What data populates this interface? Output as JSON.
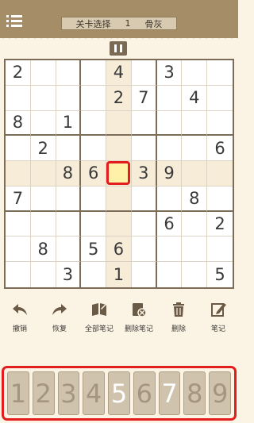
{
  "header": {
    "level_label": "关卡选择",
    "level_number": "1",
    "difficulty": "骨灰"
  },
  "board": [
    [
      "2",
      "",
      "",
      "",
      "4",
      "",
      "3",
      "",
      ""
    ],
    [
      "",
      "",
      "",
      "",
      "2",
      "7",
      "",
      "4",
      ""
    ],
    [
      "8",
      "",
      "1",
      "",
      "",
      "",
      "",
      "",
      ""
    ],
    [
      "",
      "2",
      "",
      "",
      "",
      "",
      "",
      "",
      "6"
    ],
    [
      "",
      "",
      "8",
      "6",
      "",
      "3",
      "9",
      "",
      ""
    ],
    [
      "7",
      "",
      "",
      "",
      "",
      "",
      "",
      "8",
      ""
    ],
    [
      "",
      "",
      "",
      "",
      "",
      "",
      "6",
      "",
      "2"
    ],
    [
      "",
      "8",
      "",
      "5",
      "6",
      "",
      "",
      "",
      ""
    ],
    [
      "",
      "",
      "3",
      "",
      "1",
      "",
      "",
      "",
      "5"
    ]
  ],
  "selected": {
    "row": 4,
    "col": 4
  },
  "tools": [
    {
      "label": "撤销",
      "icon": "undo-icon"
    },
    {
      "label": "恢复",
      "icon": "redo-icon"
    },
    {
      "label": "全部笔记",
      "icon": "book-icon"
    },
    {
      "label": "删除笔记",
      "icon": "delete-notes-icon"
    },
    {
      "label": "删除",
      "icon": "trash-icon"
    },
    {
      "label": "笔记",
      "icon": "pencil-icon"
    }
  ],
  "numbers": [
    {
      "label": "1",
      "active": false
    },
    {
      "label": "2",
      "active": false
    },
    {
      "label": "3",
      "active": false
    },
    {
      "label": "4",
      "active": false
    },
    {
      "label": "5",
      "active": true
    },
    {
      "label": "6",
      "active": false
    },
    {
      "label": "7",
      "active": true
    },
    {
      "label": "8",
      "active": false
    },
    {
      "label": "9",
      "active": false
    }
  ],
  "colors": {
    "header": "#a58e67",
    "highlight": "#e31d1d",
    "selected_fill": "#fff2a8"
  }
}
